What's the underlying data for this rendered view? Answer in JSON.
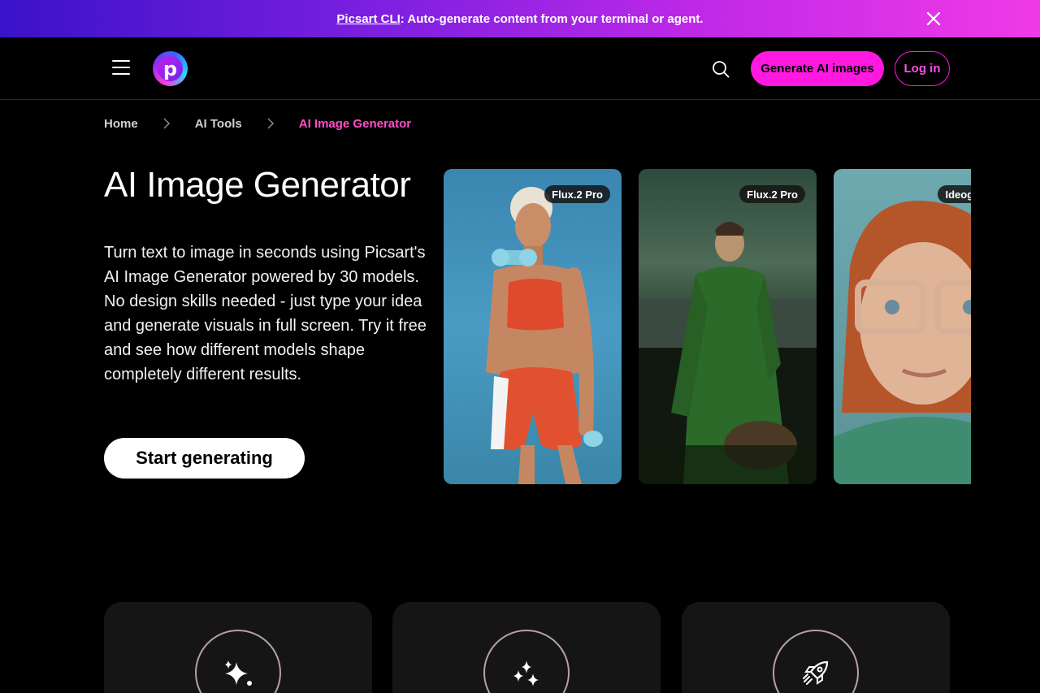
{
  "banner": {
    "link_label": "Picsart CLI",
    "text": ": Auto-generate content from your terminal or agent."
  },
  "header": {
    "logo_letter": "p",
    "generate_label": "Generate AI images",
    "login_label": "Log in"
  },
  "breadcrumb": {
    "items": [
      "Home",
      "AI Tools",
      "AI Image Generator"
    ]
  },
  "hero": {
    "title": "AI Image Generator",
    "description": "Turn text to image in seconds using Picsart's AI Image Generator powered by 30 models. No design skills needed - just type your idea and generate visuals in full screen. Try it free and see how different models shape completely different results.",
    "cta_label": "Start generating"
  },
  "gallery": {
    "cards": [
      {
        "model": "Flux.2 Pro",
        "subject": "woman-with-dumbbells"
      },
      {
        "model": "Flux.2 Pro",
        "subject": "man-in-green-robe"
      },
      {
        "model": "Ideogram",
        "subject": "red-haired-man-with-glasses"
      }
    ]
  },
  "features": [
    {
      "icon": "sparkle-icon"
    },
    {
      "icon": "sparkles-icon"
    },
    {
      "icon": "rocket-icon"
    }
  ],
  "colors": {
    "accent": "#ff18e0",
    "breadcrumb_active": "#ff4fc8",
    "background": "#000000",
    "card_bg": "#151515"
  }
}
